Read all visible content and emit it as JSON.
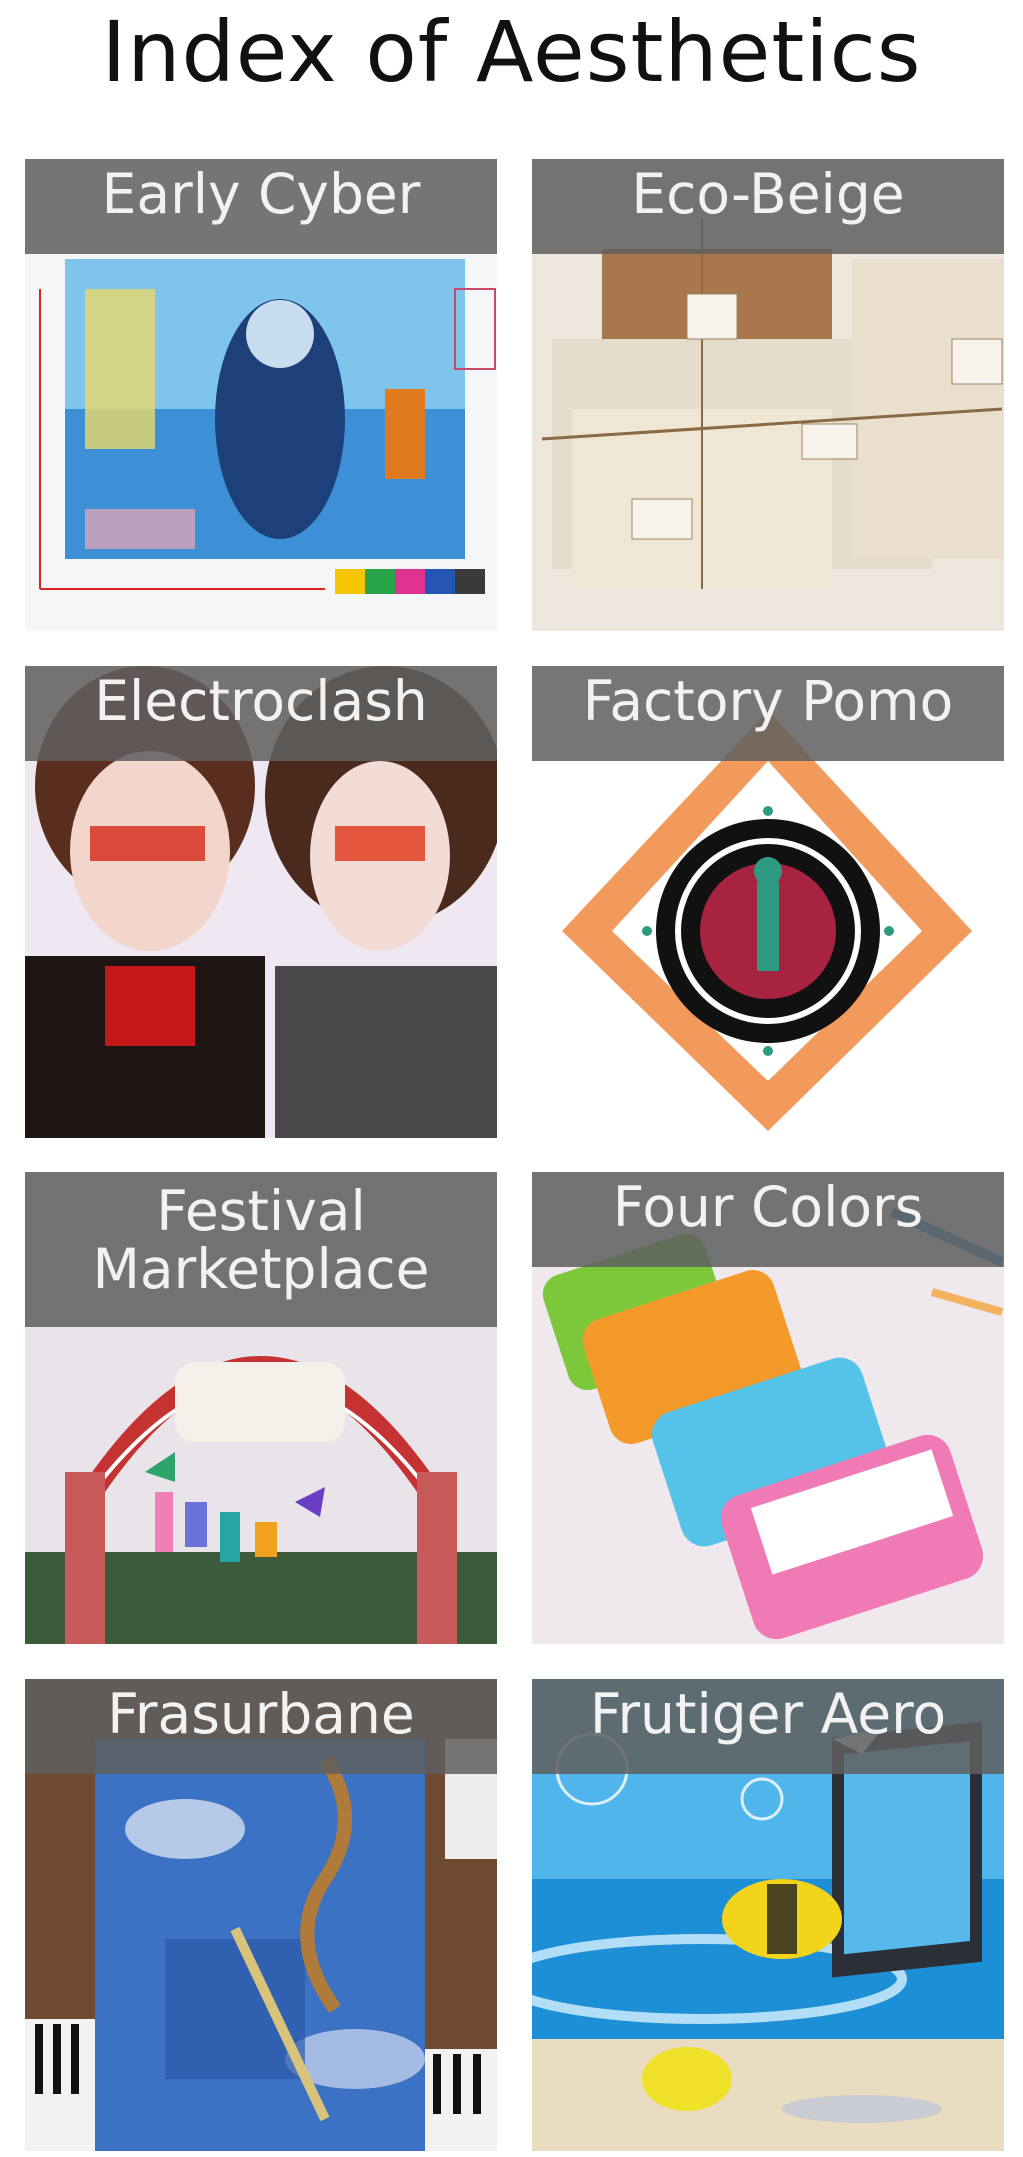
{
  "page": {
    "title": "Index of Aesthetics"
  },
  "cards": [
    {
      "label": "Early Cyber"
    },
    {
      "label": "Eco-Beige"
    },
    {
      "label": "Electroclash"
    },
    {
      "label": "Factory Pomo"
    },
    {
      "label": "Festival Marketplace"
    },
    {
      "label": "Four Colors"
    },
    {
      "label": "Frasurbane"
    },
    {
      "label": "Frutiger Aero"
    }
  ],
  "colors": {
    "label_bar": "#5f5f5f",
    "label_text": "#f2f2f2",
    "title_text": "#111111"
  }
}
